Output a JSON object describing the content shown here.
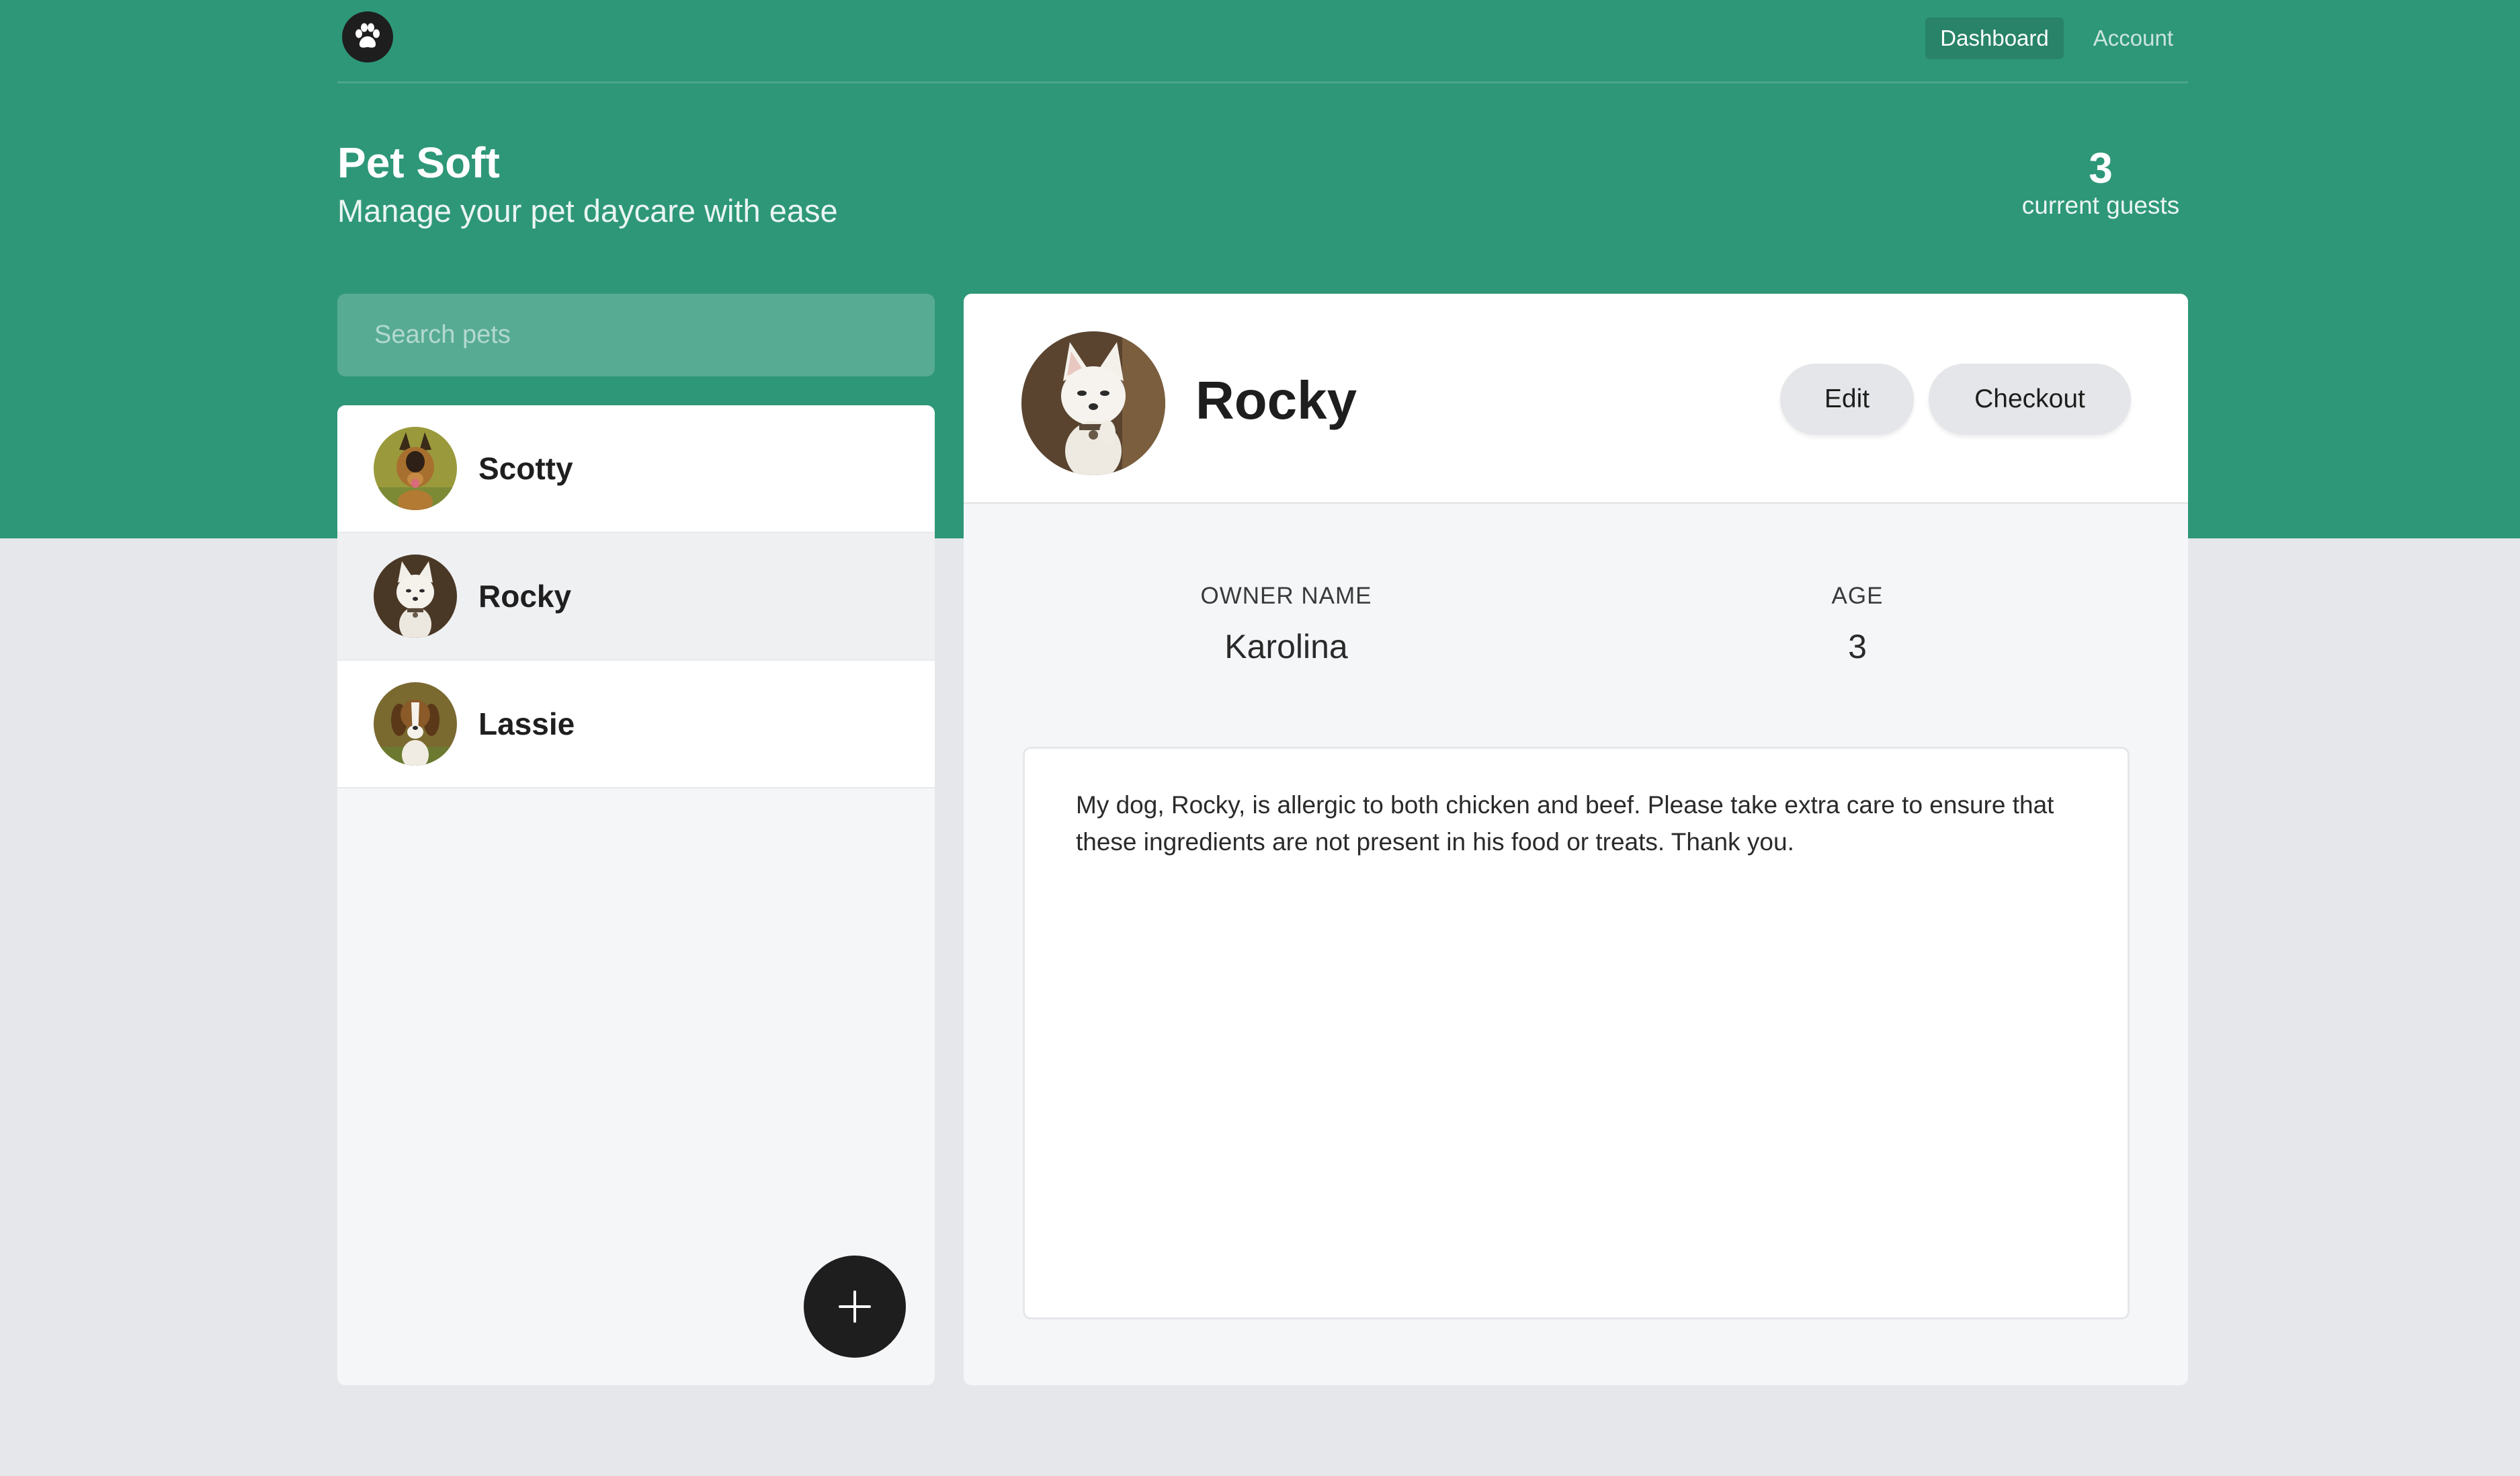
{
  "nav": {
    "items": [
      {
        "label": "Dashboard",
        "active": true
      },
      {
        "label": "Account",
        "active": false
      }
    ]
  },
  "brand": {
    "title": "Pet Soft",
    "subtitle": "Manage your pet daycare with ease"
  },
  "stats": {
    "guest_count": "3",
    "guest_label": "current guests"
  },
  "search": {
    "placeholder": "Search pets"
  },
  "pets": [
    {
      "name": "Scotty",
      "selected": false
    },
    {
      "name": "Rocky",
      "selected": true
    },
    {
      "name": "Lassie",
      "selected": false
    }
  ],
  "detail": {
    "name": "Rocky",
    "edit_label": "Edit",
    "checkout_label": "Checkout",
    "owner_label": "OWNER NAME",
    "owner_value": "Karolina",
    "age_label": "AGE",
    "age_value": "3",
    "notes": "My dog, Rocky, is allergic to both chicken and beef. Please take extra care to ensure that these ingredients are not present in his food or treats. Thank you."
  },
  "colors": {
    "brand_green": "#2e9778",
    "page_bg": "#e5e7eb",
    "dark": "#1e1e1e"
  }
}
